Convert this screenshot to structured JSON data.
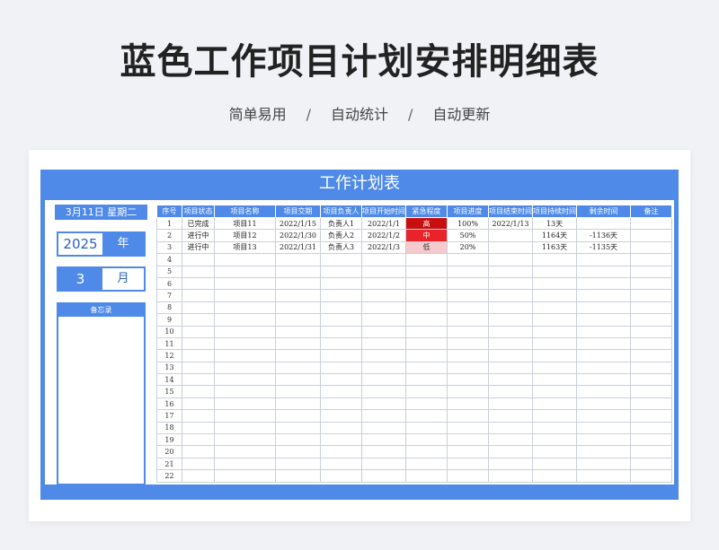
{
  "page": {
    "title": "蓝色工作项目计划安排明细表",
    "tags": [
      "简单易用",
      "自动统计",
      "自动更新"
    ],
    "separator": "/"
  },
  "sheet": {
    "title": "工作计划表",
    "date_label": "3月11日  星期二",
    "year_value": "2025",
    "year_unit": "年",
    "month_value": "3",
    "month_unit": "月",
    "memo_label": "备忘录",
    "headers": [
      "序号",
      "项目状态",
      "项目名称",
      "项目交期",
      "项目负责人",
      "项目开始时间",
      "紧急程度",
      "项目进度",
      "项目结束时间",
      "项目持续时间",
      "剩余时间",
      "备注"
    ],
    "rows": [
      {
        "seq": "1",
        "status": "已完成",
        "name": "项目11",
        "due": "2022/1/15",
        "owner": "负责人1",
        "start": "2022/1/1",
        "priority": "高",
        "priority_level": "high",
        "progress": "100%",
        "end": "2022/1/13",
        "duration": "13天",
        "remaining": "",
        "note": ""
      },
      {
        "seq": "2",
        "status": "进行中",
        "name": "项目12",
        "due": "2022/1/30",
        "owner": "负责人2",
        "start": "2022/1/2",
        "priority": "中",
        "priority_level": "mid",
        "progress": "50%",
        "end": "",
        "duration": "1164天",
        "remaining": "-1136天",
        "note": ""
      },
      {
        "seq": "3",
        "status": "进行中",
        "name": "项目13",
        "due": "2022/1/31",
        "owner": "负责人3",
        "start": "2022/1/3",
        "priority": "低",
        "priority_level": "low",
        "progress": "20%",
        "end": "",
        "duration": "1163天",
        "remaining": "-1135天",
        "note": ""
      },
      {
        "seq": "4"
      },
      {
        "seq": "5"
      },
      {
        "seq": "6"
      },
      {
        "seq": "7"
      },
      {
        "seq": "8"
      },
      {
        "seq": "9"
      },
      {
        "seq": "10"
      },
      {
        "seq": "11"
      },
      {
        "seq": "12"
      },
      {
        "seq": "13"
      },
      {
        "seq": "14"
      },
      {
        "seq": "15"
      },
      {
        "seq": "16"
      },
      {
        "seq": "17"
      },
      {
        "seq": "18"
      },
      {
        "seq": "19"
      },
      {
        "seq": "20"
      },
      {
        "seq": "21"
      },
      {
        "seq": "22"
      }
    ]
  },
  "colors": {
    "accent": "#4f8ae8",
    "priority_high": "#c80f0f",
    "priority_mid": "#e8242a",
    "priority_low": "#f6c9cc"
  }
}
